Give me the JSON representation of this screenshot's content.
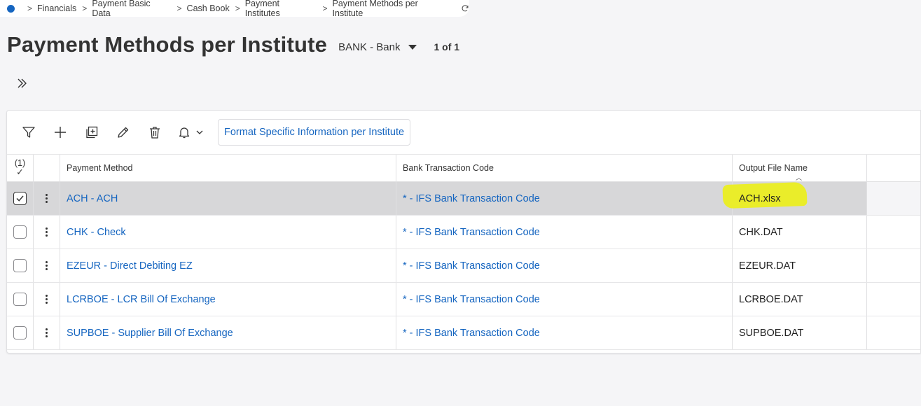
{
  "breadcrumb": {
    "items": [
      "Financials",
      "Payment Basic Data",
      "Cash Book",
      "Payment Institutes",
      "Payment Methods per Institute"
    ]
  },
  "header": {
    "title": "Payment Methods per Institute",
    "selector_value": "BANK - Bank",
    "record_count": "1 of 1"
  },
  "toolbar": {
    "icons": [
      "filter-icon",
      "add-icon",
      "duplicate-icon",
      "edit-icon",
      "delete-icon",
      "bell-icon"
    ],
    "format_button_label": "Format Specific Information per Institute"
  },
  "table": {
    "selected_count": "(1)",
    "columns": [
      "Payment Method",
      "Bank Transaction Code",
      "Output File Name"
    ],
    "rows": [
      {
        "payment_method": "ACH - ACH",
        "bank_transaction_code": "* - IFS Bank Transaction Code",
        "output_file_name": "ACH.xlsx",
        "selected": true
      },
      {
        "payment_method": "CHK - Check",
        "bank_transaction_code": "* - IFS Bank Transaction Code",
        "output_file_name": "CHK.DAT",
        "selected": false
      },
      {
        "payment_method": "EZEUR - Direct Debiting EZ",
        "bank_transaction_code": "* - IFS Bank Transaction Code",
        "output_file_name": "EZEUR.DAT",
        "selected": false
      },
      {
        "payment_method": "LCRBOE - LCR Bill Of Exchange",
        "bank_transaction_code": "* - IFS Bank Transaction Code",
        "output_file_name": "LCRBOE.DAT",
        "selected": false
      },
      {
        "payment_method": "SUPBOE - Supplier Bill Of Exchange",
        "bank_transaction_code": "* - IFS Bank Transaction Code",
        "output_file_name": "SUPBOE.DAT",
        "selected": false
      }
    ]
  },
  "colors": {
    "accent": "#1565c0",
    "highlight": "#eaed2a",
    "selected_row": "#d7d7d9"
  }
}
